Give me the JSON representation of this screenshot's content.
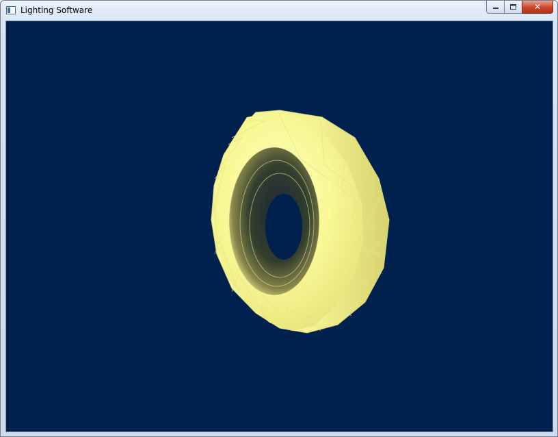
{
  "window": {
    "title": "Lighting Software",
    "buttons": {
      "minimize_icon": "minimize-icon",
      "maximize_icon": "maximize-icon",
      "close_icon": "close-icon",
      "close_glyph": "✕"
    }
  },
  "scene": {
    "background_color": "#00214d",
    "object": "torus",
    "object_color": "#f7f79a",
    "shadow_color": "#2a2a08"
  }
}
